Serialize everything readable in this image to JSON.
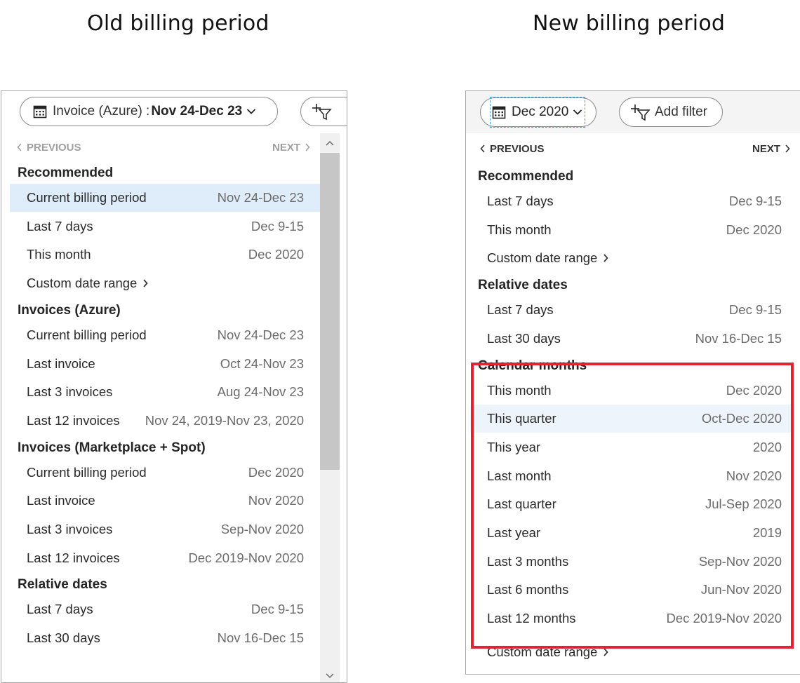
{
  "captions": {
    "old": "Old billing period",
    "new": "New billing period"
  },
  "old_panel": {
    "scope_pill": {
      "prefix": "Invoice (Azure) : ",
      "value": "Nov 24-Dec 23"
    },
    "previous_label": "PREVIOUS",
    "next_label": "NEXT",
    "sections": [
      {
        "title": "Recommended",
        "items": [
          {
            "label": "Current billing period",
            "value": "Nov 24-Dec 23",
            "selected": true
          },
          {
            "label": "Last 7 days",
            "value": "Dec 9-15"
          },
          {
            "label": "This month",
            "value": "Dec 2020"
          },
          {
            "label": "Custom date range",
            "value": ""
          }
        ]
      },
      {
        "title": "Invoices (Azure)",
        "items": [
          {
            "label": "Current billing period",
            "value": "Nov 24-Dec 23"
          },
          {
            "label": "Last invoice",
            "value": "Oct 24-Nov 23"
          },
          {
            "label": "Last 3 invoices",
            "value": "Aug 24-Nov 23"
          },
          {
            "label": "Last 12 invoices",
            "value": "Nov 24, 2019-Nov 23, 2020"
          }
        ]
      },
      {
        "title": "Invoices (Marketplace + Spot)",
        "items": [
          {
            "label": "Current billing period",
            "value": "Dec 2020"
          },
          {
            "label": "Last invoice",
            "value": "Nov 2020"
          },
          {
            "label": "Last 3 invoices",
            "value": "Sep-Nov 2020"
          },
          {
            "label": "Last 12 invoices",
            "value": "Dec 2019-Nov 2020"
          }
        ]
      },
      {
        "title": "Relative dates",
        "items": [
          {
            "label": "Last 7 days",
            "value": "Dec 9-15"
          },
          {
            "label": "Last 30 days",
            "value": "Nov 16-Dec 15"
          }
        ]
      }
    ]
  },
  "new_panel": {
    "scope_pill": {
      "value": "Dec 2020"
    },
    "add_filter_label": "Add filter",
    "previous_label": "PREVIOUS",
    "next_label": "NEXT",
    "sections": [
      {
        "title": "Recommended",
        "items": [
          {
            "label": "Last 7 days",
            "value": "Dec 9-15"
          },
          {
            "label": "This month",
            "value": "Dec 2020"
          },
          {
            "label": "Custom date range",
            "value": ""
          }
        ]
      },
      {
        "title": "Relative dates",
        "items": [
          {
            "label": "Last 7 days",
            "value": "Dec 9-15"
          },
          {
            "label": "Last 30 days",
            "value": "Nov 16-Dec 15"
          }
        ]
      },
      {
        "title": "Calendar months",
        "items": [
          {
            "label": "This month",
            "value": "Dec 2020"
          },
          {
            "label": "This quarter",
            "value": "Oct-Dec 2020",
            "hover": true
          },
          {
            "label": "This year",
            "value": "2020"
          },
          {
            "label": "Last month",
            "value": "Nov 2020"
          },
          {
            "label": "Last quarter",
            "value": "Jul-Sep 2020"
          },
          {
            "label": "Last year",
            "value": "2019"
          },
          {
            "label": "Last 3 months",
            "value": "Sep-Nov 2020"
          },
          {
            "label": "Last 6 months",
            "value": "Jun-Nov 2020"
          },
          {
            "label": "Last 12 months",
            "value": "Dec 2019-Nov 2020"
          }
        ]
      },
      {
        "title": "",
        "items": [
          {
            "label": "Custom date range",
            "value": ""
          }
        ]
      }
    ]
  },
  "colors": {
    "highlight": "#e02431",
    "selected_row": "#deedf9",
    "focus": "#3aa0d8"
  }
}
